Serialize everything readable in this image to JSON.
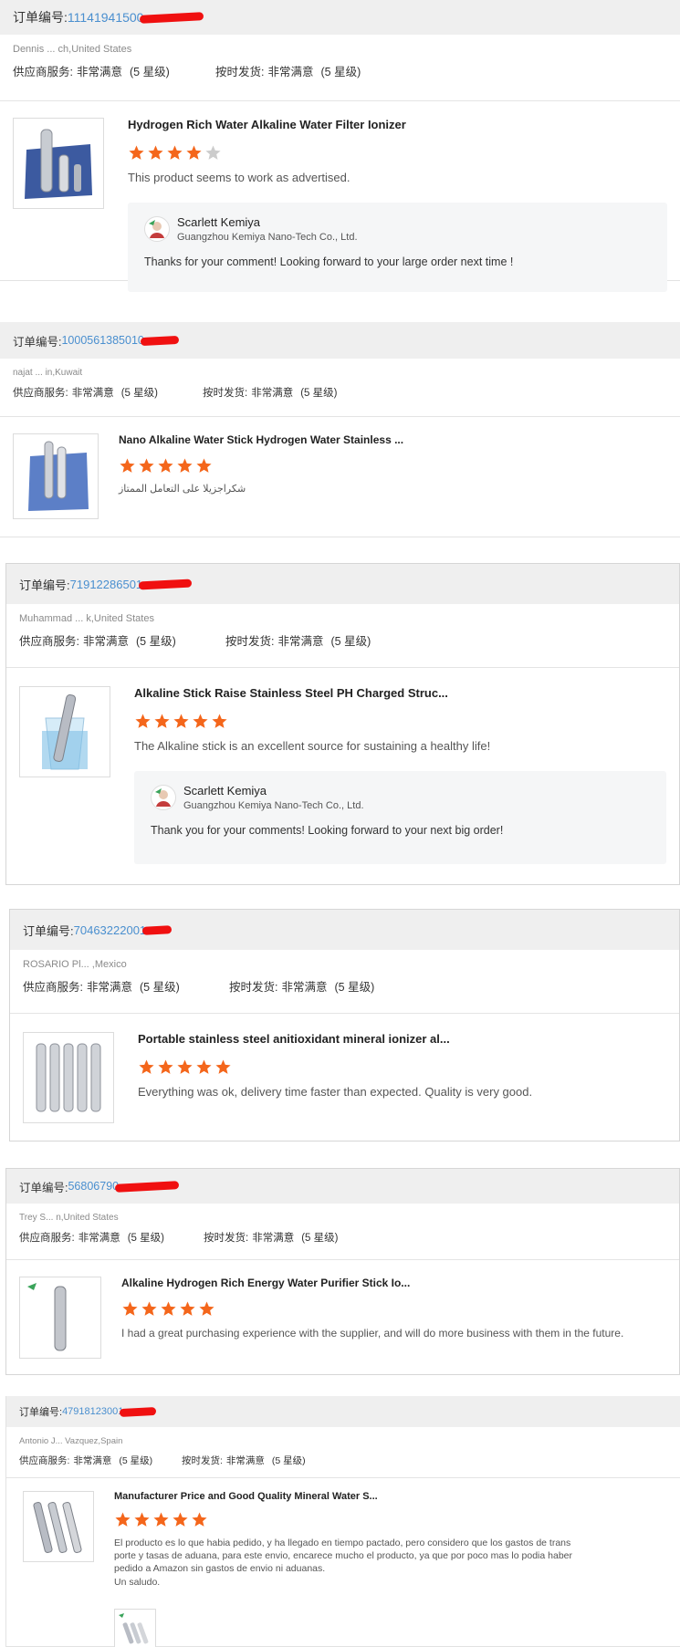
{
  "labels": {
    "order_no": "订单编号:",
    "supplier_service": "供应商服务:",
    "on_time": "按时发货:",
    "very_satisfied": "非常满意",
    "level": "(5 星级)"
  },
  "reviews": [
    {
      "order_number": "11141941500",
      "buyer": "Dennis ... ch,United States",
      "product_title": "Hydrogen Rich Water Alkaline Water Filter Ionizer",
      "rating": 4,
      "comment": "This product seems to work as advertised.",
      "reply": {
        "name": "Scarlett Kemiya",
        "company": "Guangzhou Kemiya Nano-Tech Co., Ltd.",
        "text": "Thanks for your comment! Looking forward to your large order next time !"
      }
    },
    {
      "order_number": "1000561385010",
      "buyer": "najat ... in,Kuwait",
      "product_title": "Nano Alkaline Water Stick Hydrogen Water Stainless ...",
      "rating": 5,
      "comment": "شكراجزيلا  على التعامل الممتاز"
    },
    {
      "order_number": "71912286501",
      "buyer": "Muhammad ... k,United States",
      "product_title": "Alkaline Stick Raise Stainless Steel PH Charged Struc...",
      "rating": 5,
      "comment": "The Alkaline stick is an excellent source for sustaining a healthy life!",
      "reply": {
        "name": "Scarlett Kemiya",
        "company": "Guangzhou Kemiya Nano-Tech Co., Ltd.",
        "text": "Thank you for your comments! Looking forward to your next big order!"
      }
    },
    {
      "order_number": "70463222001",
      "buyer": "ROSARIO Pl... ,Mexico",
      "product_title": "Portable stainless steel anitioxidant mineral ionizer al...",
      "rating": 5,
      "comment": "Everything was ok, delivery time faster than expected. Quality is very good."
    },
    {
      "order_number": "56806790",
      "buyer": "Trey S... n,United States",
      "product_title": "Alkaline Hydrogen Rich Energy Water Purifier Stick Io...",
      "rating": 5,
      "comment": "I had a great purchasing experience with the supplier, and will do more business with them in the future."
    },
    {
      "order_number": "47918123001",
      "buyer": "Antonio J... Vazquez,Spain",
      "product_title": "Manufacturer Price and Good Quality Mineral Water S...",
      "rating": 5,
      "comment": "El producto es lo que habia pedido, y ha llegado en tiempo pactado, pero considero que los gastos de trans porte y tasas de aduana, para este envio, encarece mucho el producto, ya que por poco mas lo podia haber pedido a Amazon sin gastos de envio ni aduanas.\nUn saludo."
    }
  ],
  "colors": {
    "order_link": "#4a8fcf",
    "star_on": "#f4661b",
    "star_off": "#cccccc",
    "redaction": "#f01010"
  }
}
